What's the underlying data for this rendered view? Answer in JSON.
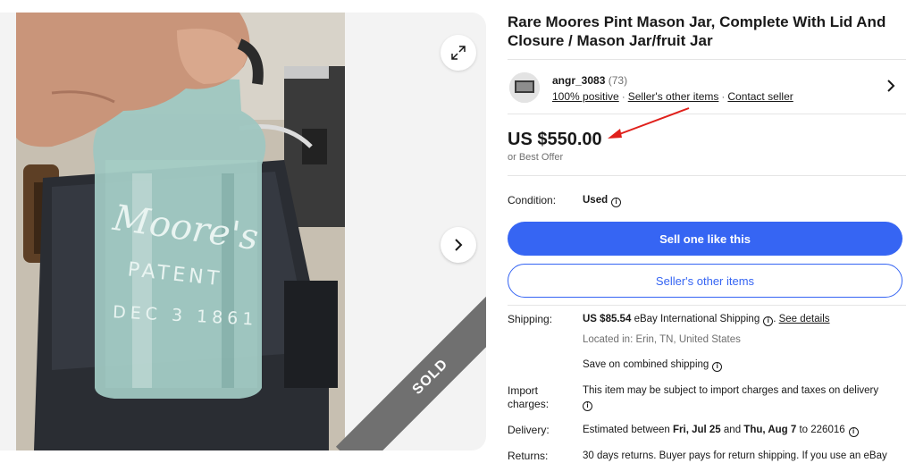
{
  "listing": {
    "title": "Rare Moores Pint Mason Jar, Complete With Lid And Closure / Mason Jar/fruit Jar",
    "sold_label": "SOLD"
  },
  "seller": {
    "name": "angr_3083",
    "count": "(73)",
    "feedback": "100% positive",
    "other_items": "Seller's other items",
    "contact": "Contact seller"
  },
  "price": {
    "amount": "US $550.00",
    "offer": "or Best Offer"
  },
  "condition": {
    "label": "Condition:",
    "value": "Used"
  },
  "buttons": {
    "sell_like": "Sell one like this",
    "other_items": "Seller's other items"
  },
  "shipping": {
    "label": "Shipping:",
    "cost": "US $85.54",
    "method": "eBay International Shipping",
    "details": "See details",
    "location": "Located in: Erin, TN, United States",
    "combined": "Save on combined shipping"
  },
  "import": {
    "label_line1": "Import",
    "label_line2": "charges:",
    "text": "This item may be subject to import charges and taxes on delivery"
  },
  "delivery": {
    "label": "Delivery:",
    "prefix": "Estimated between",
    "start": "Fri, Jul 25",
    "and": "and",
    "end": "Thu, Aug 7",
    "to": "to 226016"
  },
  "returns": {
    "label": "Returns:",
    "text": "30 days returns. Buyer pays for return shipping. If you use an eBay"
  },
  "photo": {
    "jar_text_1": "Moore's",
    "jar_text_2": "PATENT",
    "jar_text_3": "DEC 3 1861"
  },
  "colors": {
    "accent_blue": "#3665f3",
    "annotation_red": "#e0201b",
    "sold_gray": "#707070"
  },
  "icons": [
    "expand-icon",
    "chevron-right-icon",
    "info-icon",
    "arrow-annotation-icon"
  ]
}
